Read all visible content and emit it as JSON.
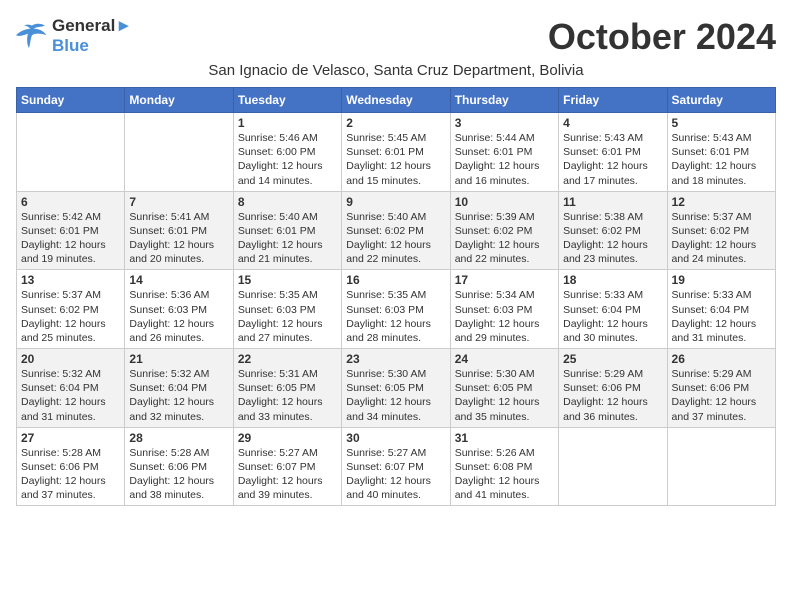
{
  "logo": {
    "line1": "General",
    "line2": "Blue"
  },
  "title": "October 2024",
  "subtitle": "San Ignacio de Velasco, Santa Cruz Department, Bolivia",
  "days_of_week": [
    "Sunday",
    "Monday",
    "Tuesday",
    "Wednesday",
    "Thursday",
    "Friday",
    "Saturday"
  ],
  "weeks": [
    [
      {
        "day": "",
        "info": ""
      },
      {
        "day": "",
        "info": ""
      },
      {
        "day": "1",
        "info": "Sunrise: 5:46 AM\nSunset: 6:00 PM\nDaylight: 12 hours and 14 minutes."
      },
      {
        "day": "2",
        "info": "Sunrise: 5:45 AM\nSunset: 6:01 PM\nDaylight: 12 hours and 15 minutes."
      },
      {
        "day": "3",
        "info": "Sunrise: 5:44 AM\nSunset: 6:01 PM\nDaylight: 12 hours and 16 minutes."
      },
      {
        "day": "4",
        "info": "Sunrise: 5:43 AM\nSunset: 6:01 PM\nDaylight: 12 hours and 17 minutes."
      },
      {
        "day": "5",
        "info": "Sunrise: 5:43 AM\nSunset: 6:01 PM\nDaylight: 12 hours and 18 minutes."
      }
    ],
    [
      {
        "day": "6",
        "info": "Sunrise: 5:42 AM\nSunset: 6:01 PM\nDaylight: 12 hours and 19 minutes."
      },
      {
        "day": "7",
        "info": "Sunrise: 5:41 AM\nSunset: 6:01 PM\nDaylight: 12 hours and 20 minutes."
      },
      {
        "day": "8",
        "info": "Sunrise: 5:40 AM\nSunset: 6:01 PM\nDaylight: 12 hours and 21 minutes."
      },
      {
        "day": "9",
        "info": "Sunrise: 5:40 AM\nSunset: 6:02 PM\nDaylight: 12 hours and 22 minutes."
      },
      {
        "day": "10",
        "info": "Sunrise: 5:39 AM\nSunset: 6:02 PM\nDaylight: 12 hours and 22 minutes."
      },
      {
        "day": "11",
        "info": "Sunrise: 5:38 AM\nSunset: 6:02 PM\nDaylight: 12 hours and 23 minutes."
      },
      {
        "day": "12",
        "info": "Sunrise: 5:37 AM\nSunset: 6:02 PM\nDaylight: 12 hours and 24 minutes."
      }
    ],
    [
      {
        "day": "13",
        "info": "Sunrise: 5:37 AM\nSunset: 6:02 PM\nDaylight: 12 hours and 25 minutes."
      },
      {
        "day": "14",
        "info": "Sunrise: 5:36 AM\nSunset: 6:03 PM\nDaylight: 12 hours and 26 minutes."
      },
      {
        "day": "15",
        "info": "Sunrise: 5:35 AM\nSunset: 6:03 PM\nDaylight: 12 hours and 27 minutes."
      },
      {
        "day": "16",
        "info": "Sunrise: 5:35 AM\nSunset: 6:03 PM\nDaylight: 12 hours and 28 minutes."
      },
      {
        "day": "17",
        "info": "Sunrise: 5:34 AM\nSunset: 6:03 PM\nDaylight: 12 hours and 29 minutes."
      },
      {
        "day": "18",
        "info": "Sunrise: 5:33 AM\nSunset: 6:04 PM\nDaylight: 12 hours and 30 minutes."
      },
      {
        "day": "19",
        "info": "Sunrise: 5:33 AM\nSunset: 6:04 PM\nDaylight: 12 hours and 31 minutes."
      }
    ],
    [
      {
        "day": "20",
        "info": "Sunrise: 5:32 AM\nSunset: 6:04 PM\nDaylight: 12 hours and 31 minutes."
      },
      {
        "day": "21",
        "info": "Sunrise: 5:32 AM\nSunset: 6:04 PM\nDaylight: 12 hours and 32 minutes."
      },
      {
        "day": "22",
        "info": "Sunrise: 5:31 AM\nSunset: 6:05 PM\nDaylight: 12 hours and 33 minutes."
      },
      {
        "day": "23",
        "info": "Sunrise: 5:30 AM\nSunset: 6:05 PM\nDaylight: 12 hours and 34 minutes."
      },
      {
        "day": "24",
        "info": "Sunrise: 5:30 AM\nSunset: 6:05 PM\nDaylight: 12 hours and 35 minutes."
      },
      {
        "day": "25",
        "info": "Sunrise: 5:29 AM\nSunset: 6:06 PM\nDaylight: 12 hours and 36 minutes."
      },
      {
        "day": "26",
        "info": "Sunrise: 5:29 AM\nSunset: 6:06 PM\nDaylight: 12 hours and 37 minutes."
      }
    ],
    [
      {
        "day": "27",
        "info": "Sunrise: 5:28 AM\nSunset: 6:06 PM\nDaylight: 12 hours and 37 minutes."
      },
      {
        "day": "28",
        "info": "Sunrise: 5:28 AM\nSunset: 6:06 PM\nDaylight: 12 hours and 38 minutes."
      },
      {
        "day": "29",
        "info": "Sunrise: 5:27 AM\nSunset: 6:07 PM\nDaylight: 12 hours and 39 minutes."
      },
      {
        "day": "30",
        "info": "Sunrise: 5:27 AM\nSunset: 6:07 PM\nDaylight: 12 hours and 40 minutes."
      },
      {
        "day": "31",
        "info": "Sunrise: 5:26 AM\nSunset: 6:08 PM\nDaylight: 12 hours and 41 minutes."
      },
      {
        "day": "",
        "info": ""
      },
      {
        "day": "",
        "info": ""
      }
    ]
  ]
}
